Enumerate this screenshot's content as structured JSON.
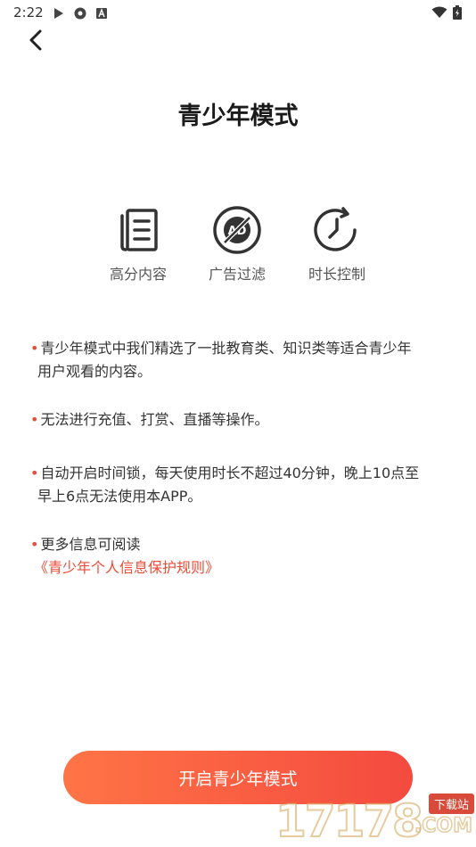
{
  "status_bar": {
    "time": "2:22",
    "left_icons": [
      "play-icon",
      "settings-icon",
      "a-icon"
    ],
    "right_icons": [
      "wifi-icon",
      "battery-icon"
    ]
  },
  "header": {
    "back_icon": "chevron-left-icon",
    "title": "青少年模式"
  },
  "features": [
    {
      "icon": "document-icon",
      "label": "高分内容"
    },
    {
      "icon": "no-ad-icon",
      "label": "广告过滤"
    },
    {
      "icon": "timer-icon",
      "label": "时长控制"
    }
  ],
  "rules": [
    {
      "bullet": "•",
      "lines": [
        "青少年模式中我们精选了一批教育类、知识类等适合青少年",
        "用户观看的内容。"
      ]
    },
    {
      "bullet": "•",
      "lines": [
        "无法进行充值、打赏、直播等操作。"
      ]
    },
    {
      "bullet": "•",
      "lines": [
        "自动开启时间锁，每天使用时长不超过40分钟，晚上10点至",
        "早上6点无法使用本APP。"
      ]
    },
    {
      "bullet": "•",
      "lines": [
        "更多信息可阅读"
      ],
      "link": "《青少年个人信息保护规则》"
    }
  ],
  "primary_button": {
    "label": "开启青少年模式"
  },
  "watermark": {
    "number": "17178",
    "badge": "下载站",
    "suffix": ".COM"
  },
  "colors": {
    "accent": "#ef4a37",
    "button_start": "#ff7446",
    "button_end": "#f44a3f"
  }
}
